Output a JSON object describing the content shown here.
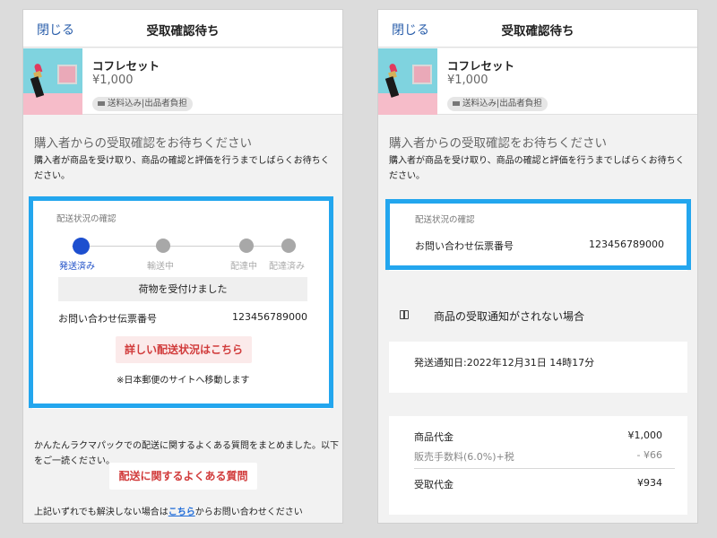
{
  "header": {
    "close_label": "閉じる",
    "title": "受取確認待ち"
  },
  "product": {
    "name": "コフレセット",
    "price": "¥1,000",
    "shipping_badge": "送料込み|出品者負担"
  },
  "waiting": {
    "title": "購入者からの受取確認をお待ちください",
    "description": "購入者が商品を受け取り、商品の確認と評価を行うまでしばらくお待ちください。"
  },
  "delivery": {
    "section_label": "配送状況の確認",
    "steps": [
      {
        "label": "発送済み",
        "active": true
      },
      {
        "label": "輸送中",
        "active": false
      },
      {
        "label": "配達中",
        "active": false
      },
      {
        "label": "配達済み",
        "active": false
      }
    ],
    "received_label": "荷物を受付けました",
    "tracking_label": "お問い合わせ伝票番号",
    "tracking_number": "123456789000",
    "detail_button": "詳しい配送状況はこちら",
    "note": "※日本郵便のサイトへ移動します"
  },
  "faq": {
    "text": "かんたんラクマパックでの配送に関するよくある質問をまとめました。以下をご一読ください。",
    "button": "配送に関するよくある質問",
    "bottom_before": "上記いずれでも解決しない場合は",
    "bottom_link": "こちら",
    "bottom_after": "からお問い合わせください"
  },
  "notice": {
    "label": "商品の受取通知がされない場合"
  },
  "shipping_notice": {
    "text": "発送通知日:2022年12月31日 14時17分"
  },
  "fees": [
    {
      "label": "商品代金",
      "value": "¥1,000",
      "muted": false
    },
    {
      "label": "販売手数料(6.0%)+税",
      "value": "- ¥66",
      "muted": true
    },
    {
      "label": "受取代金",
      "value": "¥934",
      "muted": false
    }
  ],
  "colors": {
    "highlight": "#23a6ee",
    "accent_red": "#d13b3b",
    "link_blue": "#2b5fab",
    "active_step": "#1d4fcf"
  }
}
